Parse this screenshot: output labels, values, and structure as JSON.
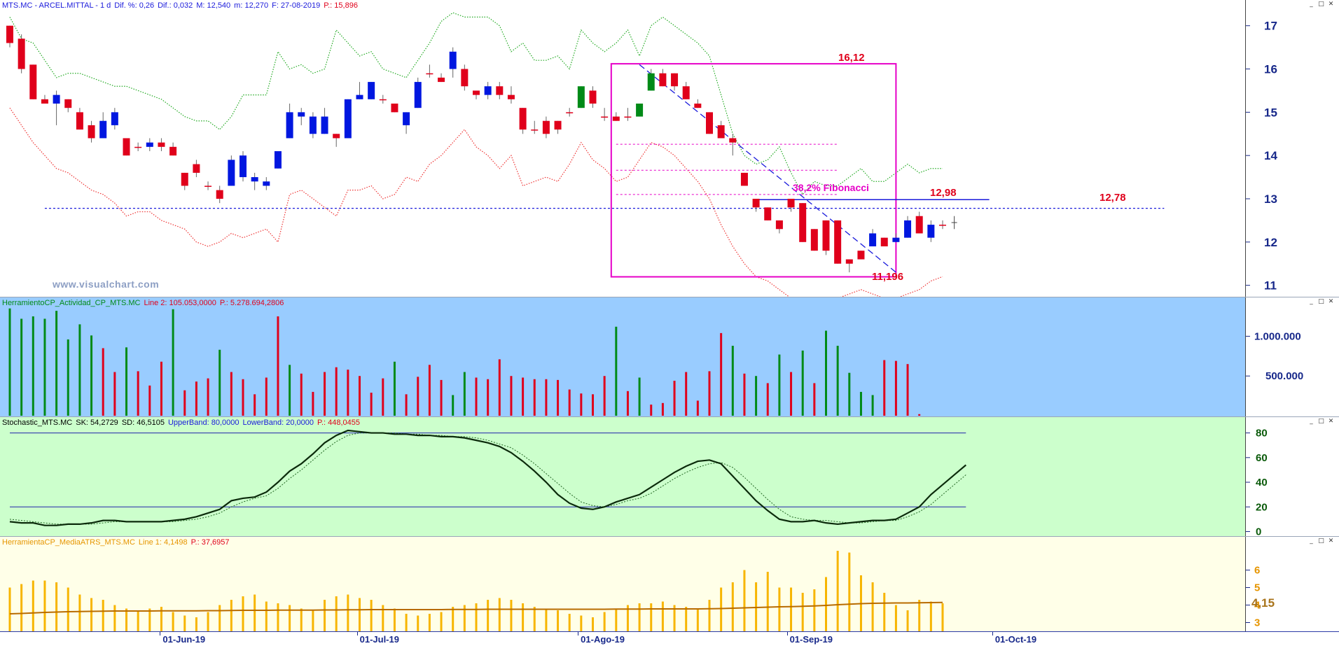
{
  "colors": {
    "up": "#0017e0",
    "down": "#e0001b",
    "green": "#008a17",
    "magenta": "#e600c8",
    "gold": "#f7b500",
    "blueLine": "#1a1adb"
  },
  "price_pane": {
    "header": [
      {
        "text": "MTS.MC - ARCEL.MITTAL -  1 d",
        "color": "#1a1adb"
      },
      {
        "text": "Dif. %: 0,26",
        "color": "#1a1adb"
      },
      {
        "text": "Dif.: 0,032",
        "color": "#1a1adb"
      },
      {
        "text": "M: 12,540",
        "color": "#1a1adb"
      },
      {
        "text": "m: 12,270",
        "color": "#1a1adb"
      },
      {
        "text": "F: 27-08-2019",
        "color": "#1a1adb"
      },
      {
        "text": "P.: 15,896",
        "color": "#e0001b"
      }
    ],
    "watermark": "www.visualchart.com",
    "annotations": {
      "top": "16,12",
      "fib": "38,2% Fibonacci",
      "h1": "12,98",
      "h2": "12,78",
      "bottom": "11,196"
    }
  },
  "volume_pane": {
    "header": [
      {
        "text": "HerramientoCP_Actividad_CP_MTS.MC",
        "color": "#008a17"
      },
      {
        "text": "Line 2: 105.053,0000",
        "color": "#e0001b"
      },
      {
        "text": "P.: 5.278.694,2806",
        "color": "#e0001b"
      }
    ]
  },
  "stoch_pane": {
    "header": [
      {
        "text": "Stochastic_MTS.MC",
        "color": "#000000"
      },
      {
        "text": "SK: 54,2729",
        "color": "#000000"
      },
      {
        "text": "SD: 46,5105",
        "color": "#000000"
      },
      {
        "text": "UpperBand: 80,0000",
        "color": "#1a1adb"
      },
      {
        "text": "LowerBand: 20,0000",
        "color": "#1a1adb"
      },
      {
        "text": "P.: 448,0455",
        "color": "#e0001b"
      }
    ]
  },
  "atr_pane": {
    "header": [
      {
        "text": "HerramientaCP_MediaATRS_MTS.MC",
        "color": "#e69500"
      },
      {
        "text": "Line 1: 4,1498",
        "color": "#e69500"
      },
      {
        "text": "P.: 37,6957",
        "color": "#e0001b"
      }
    ]
  },
  "chart_data": {
    "type": "candlestick",
    "x_tick_labels": [
      "01-Jun-19",
      "01-Jul-19",
      "01-Ago-19",
      "01-Sep-19",
      "01-Oct-19"
    ],
    "price": {
      "y_ticks": [
        11,
        12,
        13,
        14,
        15,
        16,
        17
      ],
      "ylim": [
        10.8,
        17.4
      ],
      "candles": [
        [
          17.0,
          17.0,
          16.5,
          16.6
        ],
        [
          16.7,
          16.8,
          15.9,
          16.0
        ],
        [
          16.1,
          16.1,
          15.3,
          15.3
        ],
        [
          15.3,
          15.4,
          15.2,
          15.2
        ],
        [
          15.2,
          15.5,
          14.7,
          15.4
        ],
        [
          15.3,
          15.3,
          15.0,
          15.1
        ],
        [
          15.0,
          15.1,
          14.6,
          14.6
        ],
        [
          14.7,
          14.8,
          14.3,
          14.4
        ],
        [
          14.4,
          15.0,
          14.4,
          14.8
        ],
        [
          14.7,
          15.1,
          14.6,
          15.0
        ],
        [
          14.4,
          14.4,
          14.0,
          14.0
        ],
        [
          14.2,
          14.3,
          14.1,
          14.2
        ],
        [
          14.2,
          14.4,
          14.1,
          14.3
        ],
        [
          14.3,
          14.4,
          14.1,
          14.2
        ],
        [
          14.2,
          14.3,
          14.0,
          14.0
        ],
        [
          13.6,
          13.6,
          13.2,
          13.3
        ],
        [
          13.8,
          13.9,
          13.5,
          13.6
        ],
        [
          13.3,
          13.4,
          13.2,
          13.3
        ],
        [
          13.2,
          13.3,
          12.9,
          13.0
        ],
        [
          13.3,
          14.0,
          13.3,
          13.9
        ],
        [
          13.5,
          14.1,
          13.4,
          14.0
        ],
        [
          13.4,
          13.6,
          13.2,
          13.5
        ],
        [
          13.3,
          13.5,
          13.2,
          13.4
        ],
        [
          13.7,
          14.1,
          13.7,
          14.1
        ],
        [
          14.4,
          15.2,
          14.4,
          15.0
        ],
        [
          14.9,
          15.1,
          14.7,
          15.0
        ],
        [
          14.5,
          15.0,
          14.4,
          14.9
        ],
        [
          14.5,
          15.1,
          14.5,
          14.9
        ],
        [
          14.5,
          14.5,
          14.2,
          14.4
        ],
        [
          14.4,
          15.3,
          14.4,
          15.3
        ],
        [
          15.3,
          15.7,
          15.3,
          15.4
        ],
        [
          15.3,
          15.7,
          15.3,
          15.7
        ],
        [
          15.3,
          15.4,
          15.2,
          15.3
        ],
        [
          15.2,
          15.2,
          15.0,
          15.0
        ],
        [
          14.7,
          15.0,
          14.5,
          15.0
        ],
        [
          15.1,
          15.8,
          15.1,
          15.7
        ],
        [
          15.9,
          16.1,
          15.8,
          15.9
        ],
        [
          15.8,
          15.9,
          15.7,
          15.7
        ],
        [
          16.0,
          16.5,
          15.8,
          16.4
        ],
        [
          16.0,
          16.1,
          15.5,
          15.6
        ],
        [
          15.5,
          15.5,
          15.3,
          15.4
        ],
        [
          15.4,
          15.7,
          15.3,
          15.6
        ],
        [
          15.6,
          15.7,
          15.3,
          15.4
        ],
        [
          15.4,
          15.6,
          15.2,
          15.3
        ],
        [
          15.1,
          15.1,
          14.5,
          14.6
        ],
        [
          14.6,
          14.8,
          14.5,
          14.6
        ],
        [
          14.8,
          14.9,
          14.4,
          14.5
        ],
        [
          14.8,
          14.8,
          14.5,
          14.6
        ],
        [
          15.0,
          15.1,
          14.9,
          15.0
        ],
        [
          15.1,
          15.6,
          15.1,
          15.6
        ],
        [
          15.5,
          15.6,
          15.1,
          15.2
        ],
        [
          14.9,
          15.1,
          14.8,
          14.9
        ],
        [
          14.9,
          15.0,
          14.8,
          14.8
        ],
        [
          14.9,
          15.1,
          14.8,
          14.9
        ],
        [
          14.9,
          15.2,
          14.9,
          15.2
        ],
        [
          15.5,
          16.0,
          15.5,
          15.9
        ],
        [
          15.9,
          16.0,
          15.6,
          15.6
        ],
        [
          15.9,
          15.9,
          15.5,
          15.6
        ],
        [
          15.6,
          15.7,
          15.3,
          15.3
        ],
        [
          15.2,
          15.3,
          15.1,
          15.1
        ],
        [
          15.0,
          15.0,
          14.5,
          14.5
        ],
        [
          14.7,
          14.8,
          14.4,
          14.4
        ],
        [
          14.4,
          14.5,
          14.0,
          14.3
        ],
        [
          13.6,
          13.6,
          13.3,
          13.3
        ],
        [
          13.0,
          13.0,
          12.7,
          12.8
        ],
        [
          12.8,
          12.8,
          12.5,
          12.5
        ],
        [
          12.5,
          12.5,
          12.2,
          12.3
        ],
        [
          13.0,
          13.0,
          12.7,
          12.8
        ],
        [
          12.9,
          12.9,
          12.0,
          12.0
        ],
        [
          12.3,
          12.3,
          11.8,
          11.8
        ],
        [
          12.5,
          12.5,
          11.7,
          11.8
        ],
        [
          12.5,
          12.5,
          11.5,
          11.5
        ],
        [
          11.6,
          11.6,
          11.3,
          11.5
        ],
        [
          11.8,
          11.8,
          11.6,
          11.6
        ],
        [
          11.9,
          12.3,
          11.9,
          12.2
        ],
        [
          12.1,
          12.1,
          11.9,
          11.9
        ],
        [
          12.0,
          12.2,
          12.0,
          12.1
        ],
        [
          12.1,
          12.6,
          12.1,
          12.5
        ],
        [
          12.6,
          12.7,
          12.2,
          12.2
        ],
        [
          12.1,
          12.5,
          12.0,
          12.4
        ],
        [
          12.4,
          12.5,
          12.3,
          12.4
        ]
      ],
      "upper_band": [
        17.2,
        16.7,
        16.6,
        16.2,
        15.8,
        15.9,
        15.9,
        15.8,
        15.7,
        15.6,
        15.6,
        15.5,
        15.4,
        15.3,
        15.1,
        14.9,
        14.8,
        14.8,
        14.6,
        14.9,
        15.4,
        15.4,
        15.4,
        16.4,
        16.0,
        16.1,
        15.9,
        16.0,
        16.9,
        16.6,
        16.3,
        16.4,
        16.0,
        15.9,
        15.8,
        16.2,
        16.6,
        17.1,
        17.3,
        17.2,
        17.2,
        17.2,
        17.0,
        16.4,
        16.6,
        16.2,
        16.2,
        16.3,
        16.0,
        16.9,
        16.6,
        16.4,
        16.6,
        16.9,
        16.3,
        17.0,
        17.2,
        17.0,
        16.8,
        16.6,
        16.3,
        15.4,
        14.5,
        14.0,
        13.8,
        13.9,
        14.2,
        13.6,
        13.1,
        13.4,
        13.3,
        13.3,
        13.5,
        13.7,
        13.4,
        13.4,
        13.6,
        13.8,
        13.6,
        13.7,
        13.7
      ],
      "lower_band": [
        15.1,
        14.7,
        14.3,
        14.0,
        13.7,
        13.6,
        13.4,
        13.2,
        13.1,
        12.9,
        12.6,
        12.7,
        12.7,
        12.5,
        12.4,
        12.3,
        12.0,
        11.9,
        12.0,
        12.2,
        12.1,
        12.2,
        12.3,
        12.0,
        13.1,
        13.2,
        13.0,
        12.8,
        12.6,
        13.2,
        13.2,
        13.3,
        13.0,
        13.1,
        13.5,
        13.4,
        13.8,
        14.0,
        14.3,
        14.6,
        14.2,
        14.0,
        13.7,
        14.0,
        13.3,
        13.4,
        13.5,
        13.4,
        13.8,
        14.3,
        13.9,
        13.7,
        13.4,
        13.5,
        13.9,
        14.3,
        14.2,
        14.0,
        13.7,
        13.4,
        13.0,
        12.4,
        11.9,
        11.5,
        11.2,
        11.1,
        10.9,
        10.7,
        10.5,
        10.7,
        10.6,
        10.7,
        10.8,
        10.9,
        10.8,
        10.7,
        10.7,
        10.8,
        10.9,
        11.1,
        11.2
      ],
      "rectangle": {
        "top": 16.12,
        "bottom": 11.196,
        "start_index": 52,
        "end_index": 76
      },
      "fib_levels": [
        14.26,
        13.66,
        13.1
      ],
      "fib_lines": {
        "start_index": 52,
        "end_index": 71
      },
      "line_12_98": {
        "value": 12.98,
        "start_index": 64,
        "end_index": 84
      },
      "line_12_78": {
        "value": 12.78,
        "start_index": 3,
        "end_index": 99
      },
      "trendline": {
        "from": [
          54,
          16.1
        ],
        "to": [
          76,
          11.3
        ]
      }
    },
    "volume": {
      "y_ticks": [
        500000,
        1000000
      ],
      "y_tick_labels": [
        "500.000",
        "1.000.000"
      ],
      "ylim": [
        0,
        1400000
      ],
      "values": [
        1350000,
        1220000,
        1250000,
        1220000,
        1320000,
        960000,
        1150000,
        1010000,
        850000,
        550000,
        860000,
        560000,
        380000,
        680000,
        1340000,
        320000,
        430000,
        470000,
        830000,
        550000,
        460000,
        270000,
        480000,
        1250000,
        640000,
        530000,
        300000,
        550000,
        610000,
        580000,
        500000,
        290000,
        470000,
        680000,
        270000,
        490000,
        640000,
        450000,
        260000,
        550000,
        480000,
        460000,
        710000,
        500000,
        480000,
        460000,
        460000,
        450000,
        330000,
        280000,
        270000,
        500000,
        1120000,
        310000,
        480000,
        140000,
        160000,
        440000,
        550000,
        190000,
        560000,
        1040000,
        880000,
        530000,
        500000,
        410000,
        770000,
        550000,
        820000,
        410000,
        1070000,
        880000,
        540000,
        300000,
        260000,
        700000,
        690000,
        650000,
        20000
      ],
      "colors": [
        "g",
        "g",
        "g",
        "g",
        "g",
        "g",
        "g",
        "g",
        "r",
        "r",
        "g",
        "r",
        "r",
        "r",
        "g",
        "r",
        "r",
        "r",
        "g",
        "r",
        "r",
        "r",
        "r",
        "r",
        "g",
        "r",
        "r",
        "r",
        "r",
        "r",
        "r",
        "r",
        "r",
        "g",
        "r",
        "r",
        "r",
        "r",
        "g",
        "g",
        "r",
        "r",
        "r",
        "r",
        "r",
        "r",
        "r",
        "r",
        "r",
        "r",
        "r",
        "r",
        "g",
        "r",
        "g",
        "r",
        "r",
        "r",
        "r",
        "r",
        "r",
        "r",
        "g",
        "r",
        "g",
        "r",
        "g",
        "r",
        "g",
        "r",
        "g",
        "g",
        "g",
        "g",
        "g",
        "r",
        "r",
        "r",
        "r"
      ]
    },
    "stochastic": {
      "y_ticks": [
        0,
        20,
        40,
        60,
        80
      ],
      "ylim": [
        -2,
        86
      ],
      "upper_band": 80,
      "lower_band": 20,
      "sk": [
        8,
        7,
        7,
        5,
        5,
        6,
        6,
        7,
        9,
        9,
        8,
        8,
        8,
        8,
        9,
        10,
        12,
        15,
        18,
        25,
        27,
        28,
        32,
        40,
        49,
        55,
        63,
        72,
        78,
        82,
        81,
        80,
        80,
        79,
        79,
        78,
        78,
        77,
        77,
        76,
        74,
        72,
        69,
        64,
        57,
        49,
        40,
        30,
        23,
        19,
        18,
        20,
        24,
        27,
        30,
        36,
        42,
        48,
        53,
        57,
        58,
        55,
        45,
        35,
        25,
        17,
        10,
        8,
        8,
        9,
        7,
        6,
        7,
        8,
        9,
        9,
        10,
        15,
        20,
        30,
        38,
        46,
        54
      ],
      "sd": [
        10,
        9,
        8,
        7,
        6,
        6,
        6,
        6,
        7,
        8,
        8,
        8,
        8,
        8,
        8,
        9,
        10,
        12,
        15,
        20,
        24,
        27,
        29,
        35,
        43,
        50,
        58,
        66,
        73,
        78,
        80,
        80,
        80,
        80,
        79,
        79,
        78,
        78,
        77,
        77,
        76,
        74,
        71,
        68,
        62,
        55,
        47,
        39,
        31,
        24,
        21,
        20,
        22,
        25,
        27,
        31,
        37,
        43,
        48,
        52,
        55,
        56,
        52,
        44,
        35,
        26,
        18,
        12,
        10,
        9,
        9,
        8,
        7,
        7,
        8,
        9,
        9,
        12,
        16,
        22,
        30,
        38,
        46
      ]
    },
    "atr": {
      "y_ticks": [
        3,
        4,
        5,
        6
      ],
      "y_tick_labels": [
        "3",
        "4",
        "5",
        "6"
      ],
      "ylim": [
        2.5,
        7.5
      ],
      "current_label": "4,15",
      "bars": [
        5.0,
        5.2,
        5.4,
        5.4,
        5.3,
        5.0,
        4.6,
        4.4,
        4.3,
        4.0,
        3.8,
        3.7,
        3.8,
        3.9,
        3.6,
        3.4,
        3.3,
        3.6,
        4.0,
        4.3,
        4.5,
        4.6,
        4.2,
        4.1,
        4.0,
        3.8,
        3.7,
        4.3,
        4.5,
        4.6,
        4.4,
        4.3,
        4.0,
        3.8,
        3.5,
        3.4,
        3.5,
        3.6,
        3.9,
        4.0,
        4.1,
        4.3,
        4.4,
        4.3,
        4.1,
        3.9,
        3.8,
        3.7,
        3.5,
        3.4,
        3.3,
        3.6,
        3.8,
        4.0,
        4.1,
        4.1,
        4.2,
        4.0,
        3.9,
        3.8,
        4.3,
        5.0,
        5.3,
        6.0,
        5.3,
        5.9,
        5.0,
        5.0,
        4.7,
        4.9,
        5.6,
        7.1,
        7.0,
        5.7,
        5.3,
        4.7,
        4.0,
        3.7,
        4.3,
        4.2,
        4.1
      ],
      "line": [
        3.5,
        3.52,
        3.55,
        3.58,
        3.6,
        3.62,
        3.63,
        3.64,
        3.65,
        3.66,
        3.66,
        3.66,
        3.66,
        3.67,
        3.67,
        3.67,
        3.67,
        3.68,
        3.68,
        3.69,
        3.7,
        3.7,
        3.7,
        3.71,
        3.71,
        3.71,
        3.71,
        3.72,
        3.72,
        3.73,
        3.73,
        3.74,
        3.74,
        3.74,
        3.74,
        3.74,
        3.74,
        3.74,
        3.75,
        3.75,
        3.75,
        3.76,
        3.76,
        3.76,
        3.76,
        3.76,
        3.76,
        3.76,
        3.76,
        3.76,
        3.76,
        3.76,
        3.77,
        3.77,
        3.77,
        3.78,
        3.78,
        3.78,
        3.78,
        3.78,
        3.79,
        3.8,
        3.82,
        3.84,
        3.86,
        3.88,
        3.9,
        3.91,
        3.93,
        3.95,
        3.98,
        4.02,
        4.05,
        4.08,
        4.1,
        4.11,
        4.12,
        4.12,
        4.13,
        4.14,
        4.15
      ]
    }
  }
}
